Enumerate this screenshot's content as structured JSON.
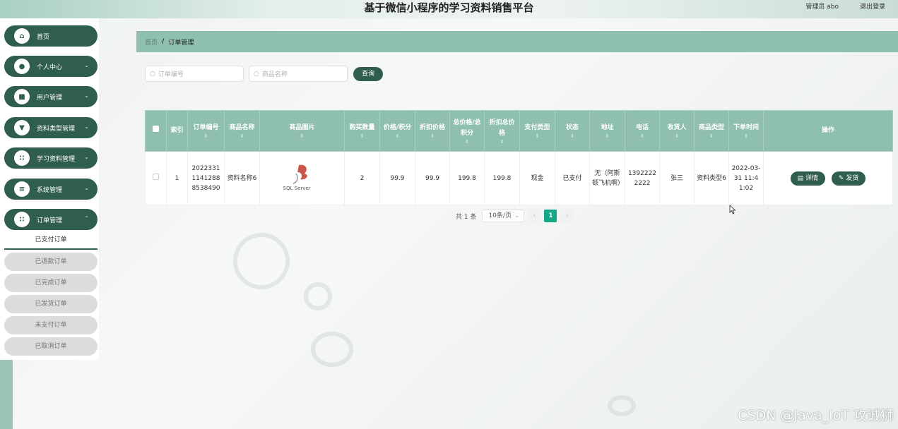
{
  "app": {
    "title": "基于微信小程序的学习资料销售平台",
    "user_label": "管理员 abo",
    "logout_label": "退出登录"
  },
  "colors": {
    "primary": "#2f5d50",
    "header_bg": "#8fbfad",
    "page_active": "#17a589"
  },
  "sidebar": {
    "items": [
      {
        "label": "首页",
        "icon": "home-icon"
      },
      {
        "label": "个人中心",
        "icon": "person-icon"
      },
      {
        "label": "用户管理",
        "icon": "user-icon"
      },
      {
        "label": "资料类型管理",
        "icon": "type-icon"
      },
      {
        "label": "学习资料管理",
        "icon": "grid-icon"
      },
      {
        "label": "系统管理",
        "icon": "list-icon"
      },
      {
        "label": "订单管理",
        "icon": "grid-icon"
      }
    ],
    "sub_items": [
      "已支付订单",
      "已退款订单",
      "已完成订单",
      "已发货订单",
      "未支付订单",
      "已取消订单"
    ]
  },
  "breadcrumb": {
    "home": "首页",
    "separator": "/",
    "current": "订单管理"
  },
  "search": {
    "order_no_placeholder": "订单编号",
    "product_name_placeholder": "商品名称",
    "button_label": "查询"
  },
  "table": {
    "headers": [
      "索引",
      "订单编号",
      "商品名称",
      "商品图片",
      "购买数量",
      "价格/积分",
      "折扣价格",
      "总价格/总积分",
      "折扣总价格",
      "支付类型",
      "状态",
      "地址",
      "电话",
      "收货人",
      "商品类型",
      "下单时间",
      "操作"
    ],
    "rows": [
      {
        "index": "1",
        "order_no": "202233111412888538490",
        "product_name": "资料名称6",
        "image_caption": "SQL Server",
        "quantity": "2",
        "price": "99.9",
        "discount_price": "99.9",
        "total": "199.8",
        "discount_total": "199.8",
        "pay_type": "现金",
        "status": "已支付",
        "address": "无（阿斯顿飞机啊）",
        "phone": "13922222222",
        "receiver": "张三",
        "product_type": "资料类型6",
        "order_time": "2022-03-31 11:41:02",
        "detail_label": "详情",
        "ship_label": "发货"
      }
    ]
  },
  "pagination": {
    "total_label": "共 1 条",
    "page_size": "10条/页",
    "current_page": "1"
  },
  "watermark": "CSDN @Java_IoT 攻诚狮"
}
